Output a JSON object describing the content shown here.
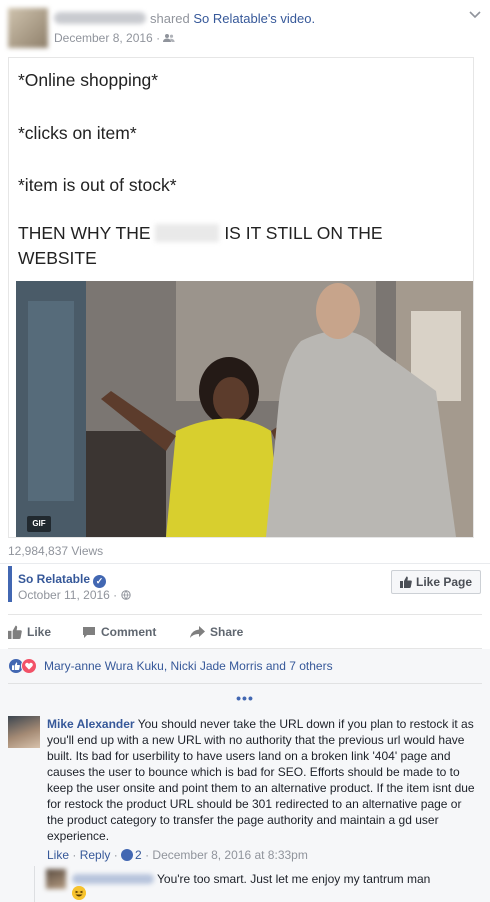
{
  "post": {
    "shared_text": "shared",
    "page_name": "So Relatable",
    "page_suffix": "'s video.",
    "date": "December 8, 2016",
    "separator": "·"
  },
  "meme": {
    "line1": "*Online shopping*",
    "line2": "*clicks on item*",
    "line3": "*item is out of stock*",
    "line4a": "THEN WHY THE",
    "line4b": "IS IT STILL ON THE",
    "line5": "WEBSITE",
    "gif_badge": "GIF"
  },
  "video": {
    "views": "12,984,837 Views"
  },
  "source": {
    "page_name": "So Relatable",
    "date": "October 11, 2016 ·",
    "like_page_label": "Like Page",
    "accent": "#4267b2"
  },
  "actions": {
    "like": "Like",
    "comment": "Comment",
    "share": "Share"
  },
  "reactions": {
    "names": "Mary-anne Wura Kuku, Nicki Jade Morris and 7 others",
    "more": "•••"
  },
  "comment": {
    "author": "Mike Alexander",
    "text": "You should never take the URL down if you plan to restock it as you'll end up with a new URL with no authority that the previous url would have built. Its bad for userbility to have users land on a broken link '404' page and causes the user to bounce which is bad for SEO. Efforts should be made to to keep the user onsite and point them to an alternative product. If the item isnt due for restock the product URL should be 301 redirected to an alternative page or the product category to transfer the page authority and maintain a gd user experience.",
    "like": "Like",
    "dot1": " · ",
    "reply": "Reply",
    "dot2": " · ",
    "like_count": "2",
    "dot3": " · ",
    "timestamp": "December 8, 2016 at 8:33pm"
  },
  "reply": {
    "text": "You're too smart. Just let me enjoy my tantrum man"
  }
}
